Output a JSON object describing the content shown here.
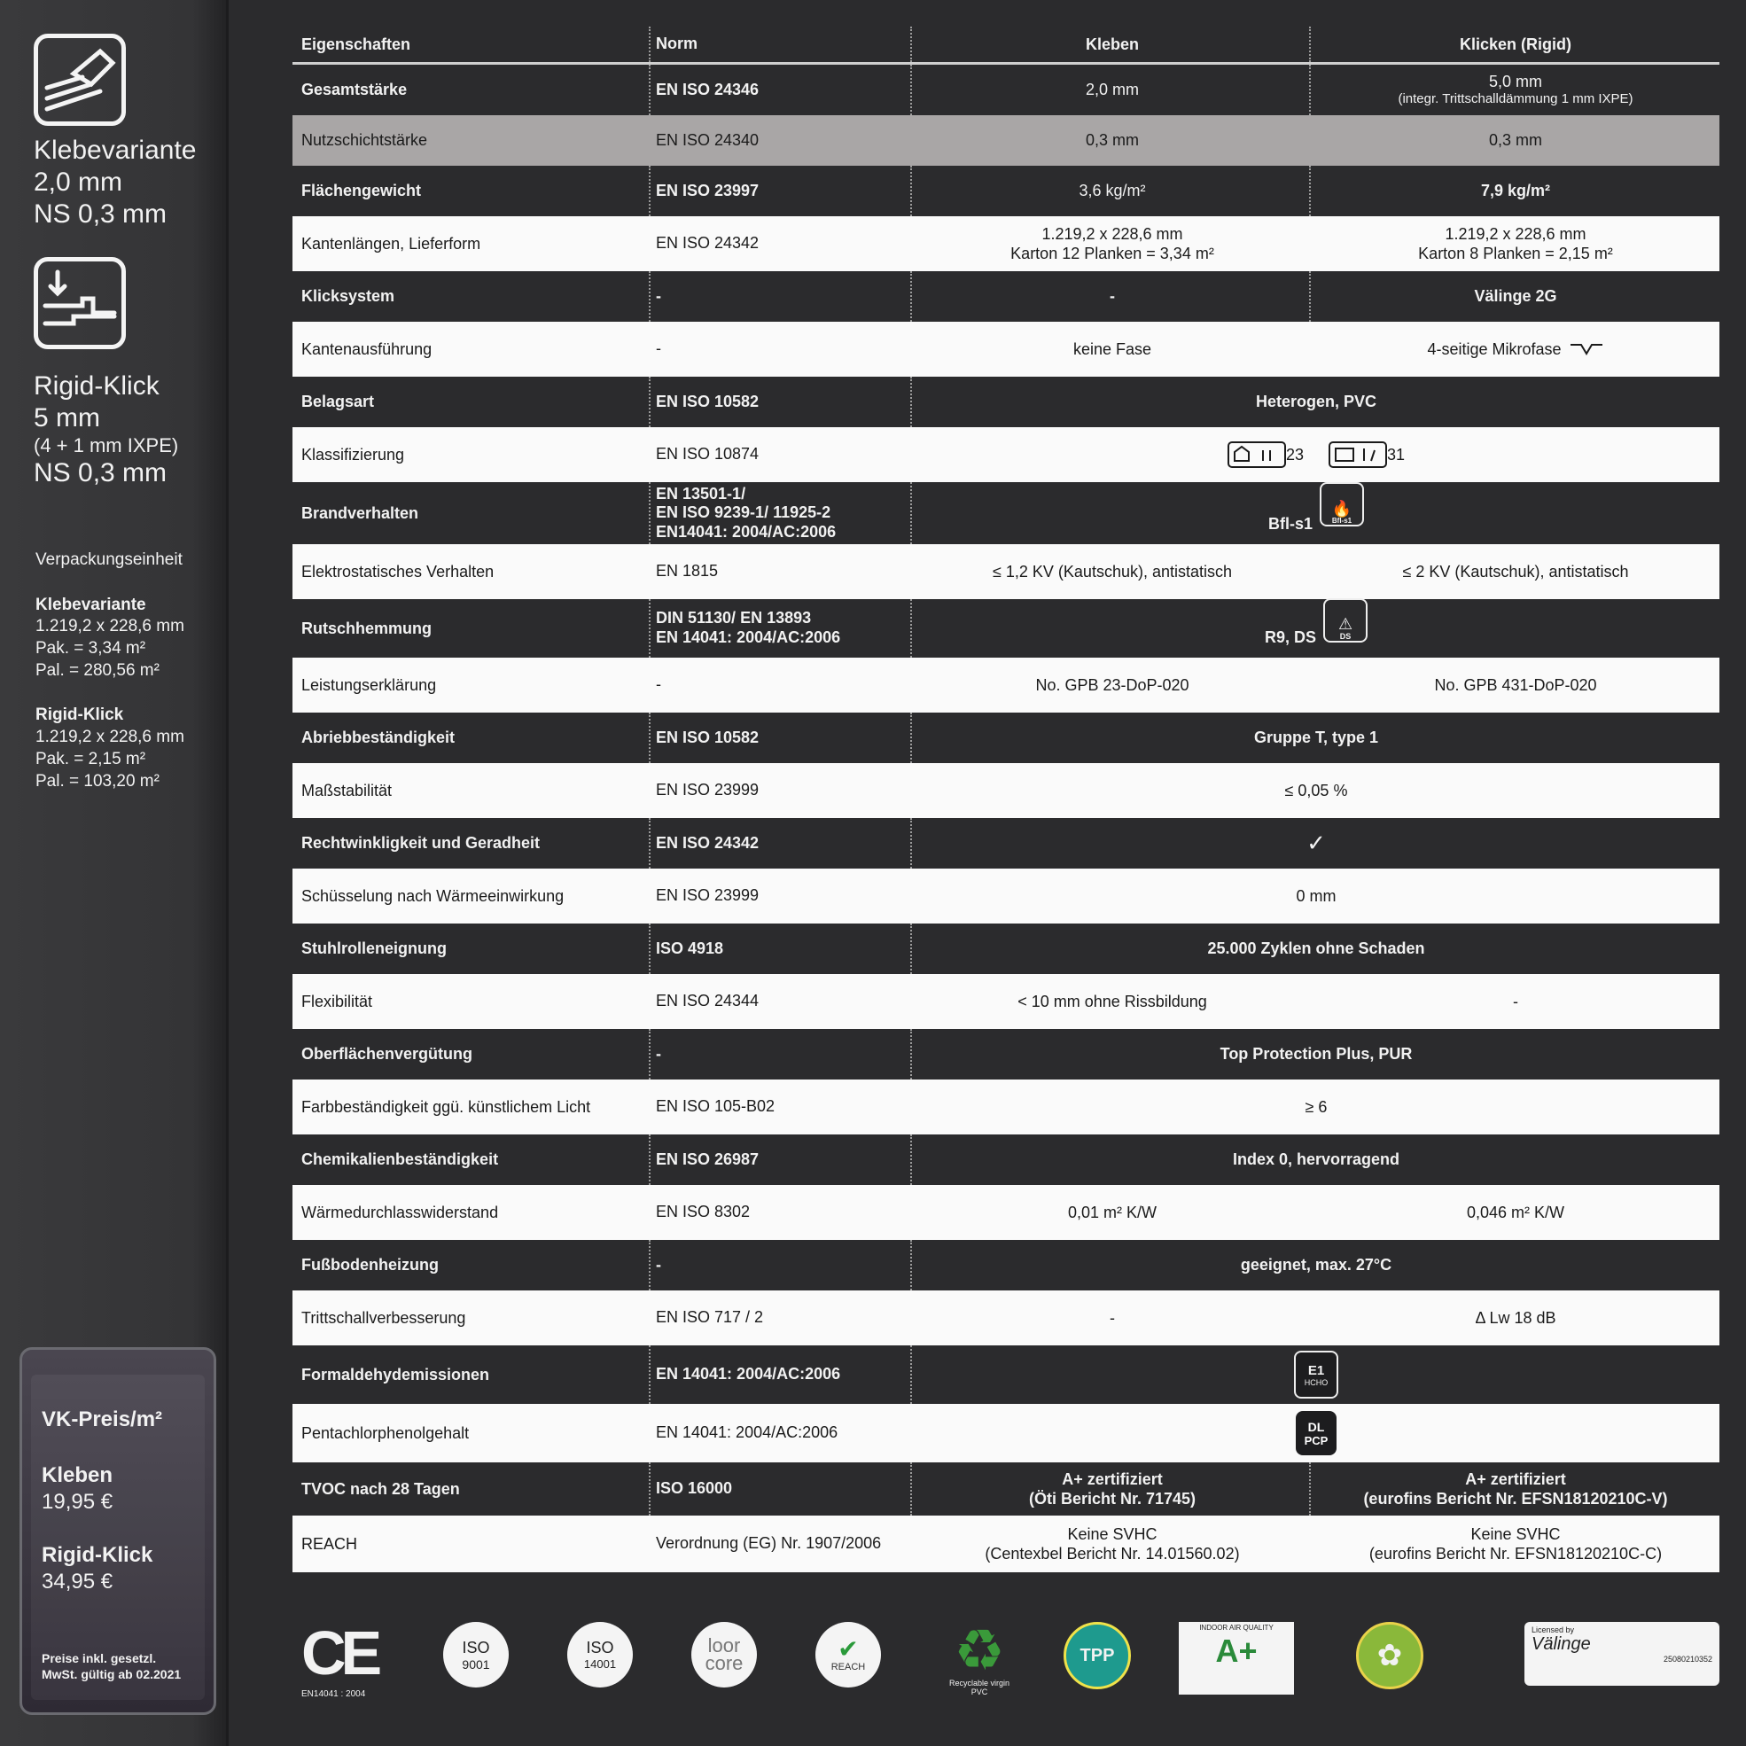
{
  "sidebar": {
    "variant1_title": "Klebevariante",
    "variant1_thickness": "2,0 mm",
    "variant1_ns": "NS 0,3 mm",
    "variant2_title": "Rigid-Klick",
    "variant2_thickness": "5 mm",
    "variant2_detail": "(4 + 1 mm IXPE)",
    "variant2_ns": "NS 0,3 mm",
    "pack_heading": "Verpackungseinheit",
    "pack1_title": "Klebevariante",
    "pack1_dim": "1.219,2 x 228,6 mm",
    "pack1_pak": "Pak. = 3,34 m²",
    "pack1_pal": "Pal. = 280,56 m²",
    "pack2_title": "Rigid-Klick",
    "pack2_dim": "1.219,2 x 228,6 mm",
    "pack2_pak": "Pak. = 2,15 m²",
    "pack2_pal": "Pal. = 103,20 m²",
    "price_heading": "VK-Preis/m²",
    "price1_label": "Kleben",
    "price1_value": "19,95 €",
    "price2_label": "Rigid-Klick",
    "price2_value": "34,95 €",
    "price_note_1": "Preise inkl. gesetzl.",
    "price_note_2": "MwSt. gültig ab 02.2021"
  },
  "table": {
    "headers": {
      "property": "Eigenschaften",
      "norm": "Norm",
      "glue": "Kleben",
      "click": "Klicken (Rigid)"
    },
    "rows": [
      {
        "property": "Gesamtstärke",
        "norm": "EN ISO 24346",
        "glue": "2,0 mm",
        "click": "5,0 mm",
        "click_note": "(integr. Trittschalldämmung 1 mm IXPE)"
      },
      {
        "property": "Nutzschichtstärke",
        "norm": "EN ISO 24340",
        "glue": "0,3 mm",
        "click": "0,3 mm"
      },
      {
        "property": "Flächengewicht",
        "norm": "EN ISO 23997",
        "glue": "3,6 kg/m²",
        "click": "7,9 kg/m²"
      },
      {
        "property": "Kantenlängen, Lieferform",
        "norm": "EN ISO 24342",
        "glue": "1.219,2 x 228,6 mm",
        "glue_2": "Karton 12 Planken = 3,34 m²",
        "click": "1.219,2 x 228,6 mm",
        "click_2": "Karton 8 Planken = 2,15 m²"
      },
      {
        "property": "Klicksystem",
        "norm": "-",
        "glue": "-",
        "click": "Välinge 2G"
      },
      {
        "property": "Kantenausführung",
        "norm": "-",
        "glue": "keine Fase",
        "click": "4-seitige Mikrofase"
      },
      {
        "property": "Belagsart",
        "norm": "EN ISO 10582",
        "both": "Heterogen, PVC"
      },
      {
        "property": "Klassifizierung",
        "norm": "EN ISO 10874",
        "class_a": "23",
        "class_b": "31"
      },
      {
        "property": "Brandverhalten",
        "norm": "EN 13501-1/",
        "norm_2": "EN ISO 9239-1/ 11925-2",
        "norm_3": "EN14041: 2004/AC:2006",
        "both": "Bfl-s1",
        "icon_label": "Bfl-s1"
      },
      {
        "property": "Elektrostatisches Verhalten",
        "norm": "EN 1815",
        "glue": "≤ 1,2 KV (Kautschuk), antistatisch",
        "click": "≤ 2 KV (Kautschuk), antistatisch"
      },
      {
        "property": "Rutschhemmung",
        "norm": "DIN 51130/ EN 13893",
        "norm_2": "EN 14041: 2004/AC:2006",
        "both": "R9, DS",
        "icon_label": "DS"
      },
      {
        "property": "Leistungserklärung",
        "norm": "-",
        "glue": "No. GPB 23-DoP-020",
        "click": "No. GPB 431-DoP-020"
      },
      {
        "property": "Abriebbeständigkeit",
        "norm": "EN ISO 10582",
        "both": "Gruppe T, type 1"
      },
      {
        "property": "Maßstabilität",
        "norm": "EN ISO 23999",
        "both": "≤ 0,05 %"
      },
      {
        "property": "Rechtwinkligkeit und Geradheit",
        "norm": "EN ISO 24342",
        "both": "✓"
      },
      {
        "property": "Schüsselung nach Wärmeeinwirkung",
        "norm": "EN ISO 23999",
        "both": "0 mm"
      },
      {
        "property": "Stuhlrolleneignung",
        "norm": "ISO 4918",
        "both": "25.000 Zyklen ohne Schaden"
      },
      {
        "property": "Flexibilität",
        "norm": "EN ISO 24344",
        "glue": "< 10 mm ohne Rissbildung",
        "click": "-"
      },
      {
        "property": "Oberflächenvergütung",
        "norm": "-",
        "both": "Top Protection Plus, PUR"
      },
      {
        "property": "Farbbeständigkeit ggü. künstlichem Licht",
        "norm": "EN ISO 105-B02",
        "both": "≥ 6"
      },
      {
        "property": "Chemikalienbeständigkeit",
        "norm": "EN ISO 26987",
        "both": "Index 0, hervorragend"
      },
      {
        "property": "Wärmedurchlasswiderstand",
        "norm": "EN ISO 8302",
        "glue": "0,01 m² K/W",
        "click": "0,046 m² K/W"
      },
      {
        "property": "Fußbodenheizung",
        "norm": "-",
        "both": "geeignet, max. 27°C"
      },
      {
        "property": "Trittschallverbesserung",
        "norm": "EN ISO 717 / 2",
        "glue": "-",
        "click": "Δ Lw 18 dB"
      },
      {
        "property": "Formaldehydemissionen",
        "norm": "EN 14041: 2004/AC:2006",
        "icon_top": "E1",
        "icon_bottom": "HCHO"
      },
      {
        "property": "Pentachlorphenolgehalt",
        "norm": "EN 14041: 2004/AC:2006",
        "icon_top": "DL",
        "icon_bottom": "PCP"
      },
      {
        "property": "TVOC nach 28 Tagen",
        "norm": "ISO 16000",
        "glue": "A+ zertifiziert",
        "glue_2": "(Öti Bericht Nr. 71745)",
        "click": "A+ zertifiziert",
        "click_2": "(eurofins Bericht Nr. EFSN18120210C-V)"
      },
      {
        "property": "REACH",
        "norm": "Verordnung (EG) Nr. 1907/2006",
        "glue": "Keine SVHC",
        "glue_2": "(Centexbel Bericht Nr. 14.01560.02)",
        "click": "Keine SVHC",
        "click_2": "(eurofins Bericht Nr. EFSN18120210C-C)"
      }
    ]
  },
  "logos": {
    "ce_note": "EN14041 : 2004",
    "iso1": "ISO",
    "iso1_num": "9001",
    "iso2": "ISO",
    "iso2_num": "14001",
    "floorcore_1": "loor",
    "floorcore_2": "core",
    "reach": "REACH",
    "recycle_note": "Recyclable virgin PVC",
    "tpp": "TPP",
    "aplus": "A+",
    "aplus_top": "INDOOR AIR QUALITY",
    "valinge_top": "Licensed by",
    "valinge_name": "Välinge",
    "valinge_code": "25080210352"
  },
  "colors": {
    "background": "#2b2b2d",
    "row_white": "#fafafa",
    "row_highlight": "#a9a6a6",
    "text_light": "#f2f2f2"
  }
}
